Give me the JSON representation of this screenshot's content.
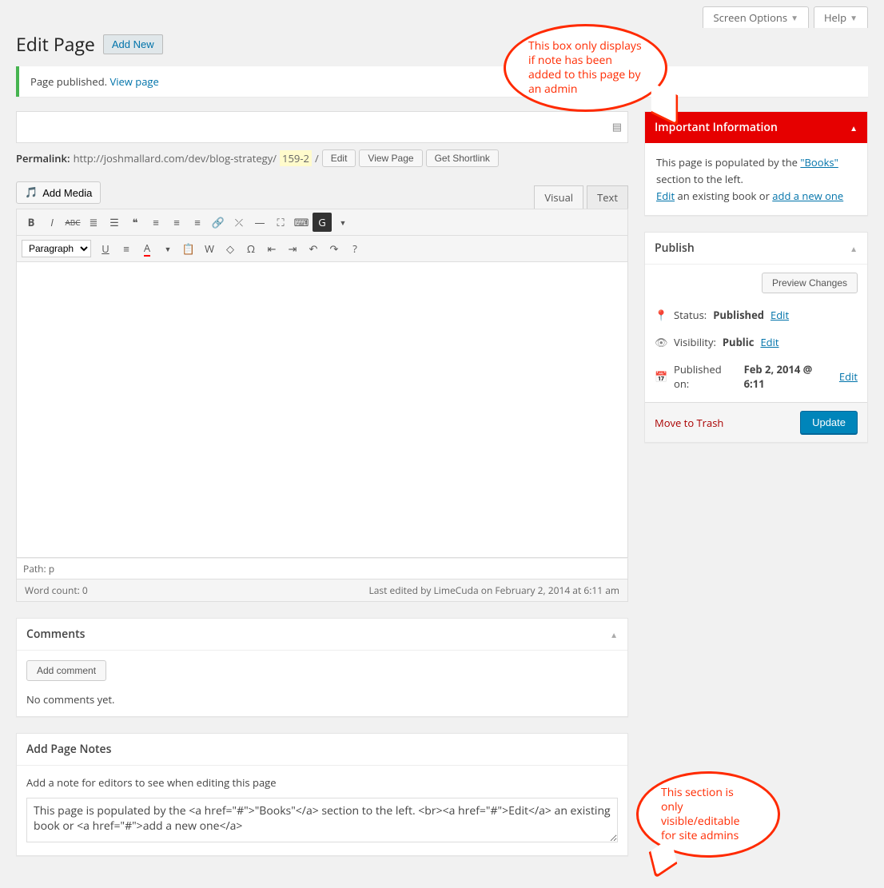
{
  "topTabs": {
    "screenOptions": "Screen Options",
    "help": "Help"
  },
  "heading": {
    "title": "Edit Page",
    "addNew": "Add New"
  },
  "notice": {
    "text": "Page published.",
    "link": "View page"
  },
  "titleField": {
    "value": ""
  },
  "permalink": {
    "label": "Permalink:",
    "urlBase": "http://joshmallard.com/dev/blog-strategy/",
    "slug": "159-2",
    "trail": "/",
    "editBtn": "Edit",
    "viewPageBtn": "View Page",
    "shortlinkBtn": "Get Shortlink"
  },
  "editor": {
    "addMedia": "Add Media",
    "tabVisual": "Visual",
    "tabText": "Text",
    "formatSelect": "Paragraph",
    "path": "Path: p",
    "wordCountLabel": "Word count: 0",
    "lastEdited": "Last edited by LimeCuda on February 2, 2014 at 6:11 am"
  },
  "comments": {
    "title": "Comments",
    "addBtn": "Add comment",
    "empty": "No comments yet."
  },
  "pageNotes": {
    "title": "Add Page Notes",
    "help": "Add a note for editors to see when editing this page",
    "value": "This page is populated by the <a href=\"#\">\"Books\"</a> section to the left. <br><a href=\"#\">Edit</a> an existing book or <a href=\"#\">add a new one</a>"
  },
  "importantBox": {
    "title": "Important Information",
    "bodyPrefix": "This page is populated by the ",
    "booksLink": "\"Books\"",
    "bodyMiddle": " section to the left.",
    "editLink": "Edit",
    "bodyMiddle2": " an existing book or ",
    "addLink": "add a new one"
  },
  "publish": {
    "title": "Publish",
    "preview": "Preview Changes",
    "statusLabel": "Status:",
    "statusValue": "Published",
    "visibilityLabel": "Visibility:",
    "visibilityValue": "Public",
    "publishedLabel": "Published on:",
    "publishedValue": "Feb 2, 2014 @ 6:11",
    "edit": "Edit",
    "trash": "Move to Trash",
    "update": "Update"
  },
  "annotations": {
    "bubble1": "This box only displays if note has been added to this page by an admin",
    "bubble2": "This section is only visible/editable for site admins"
  }
}
